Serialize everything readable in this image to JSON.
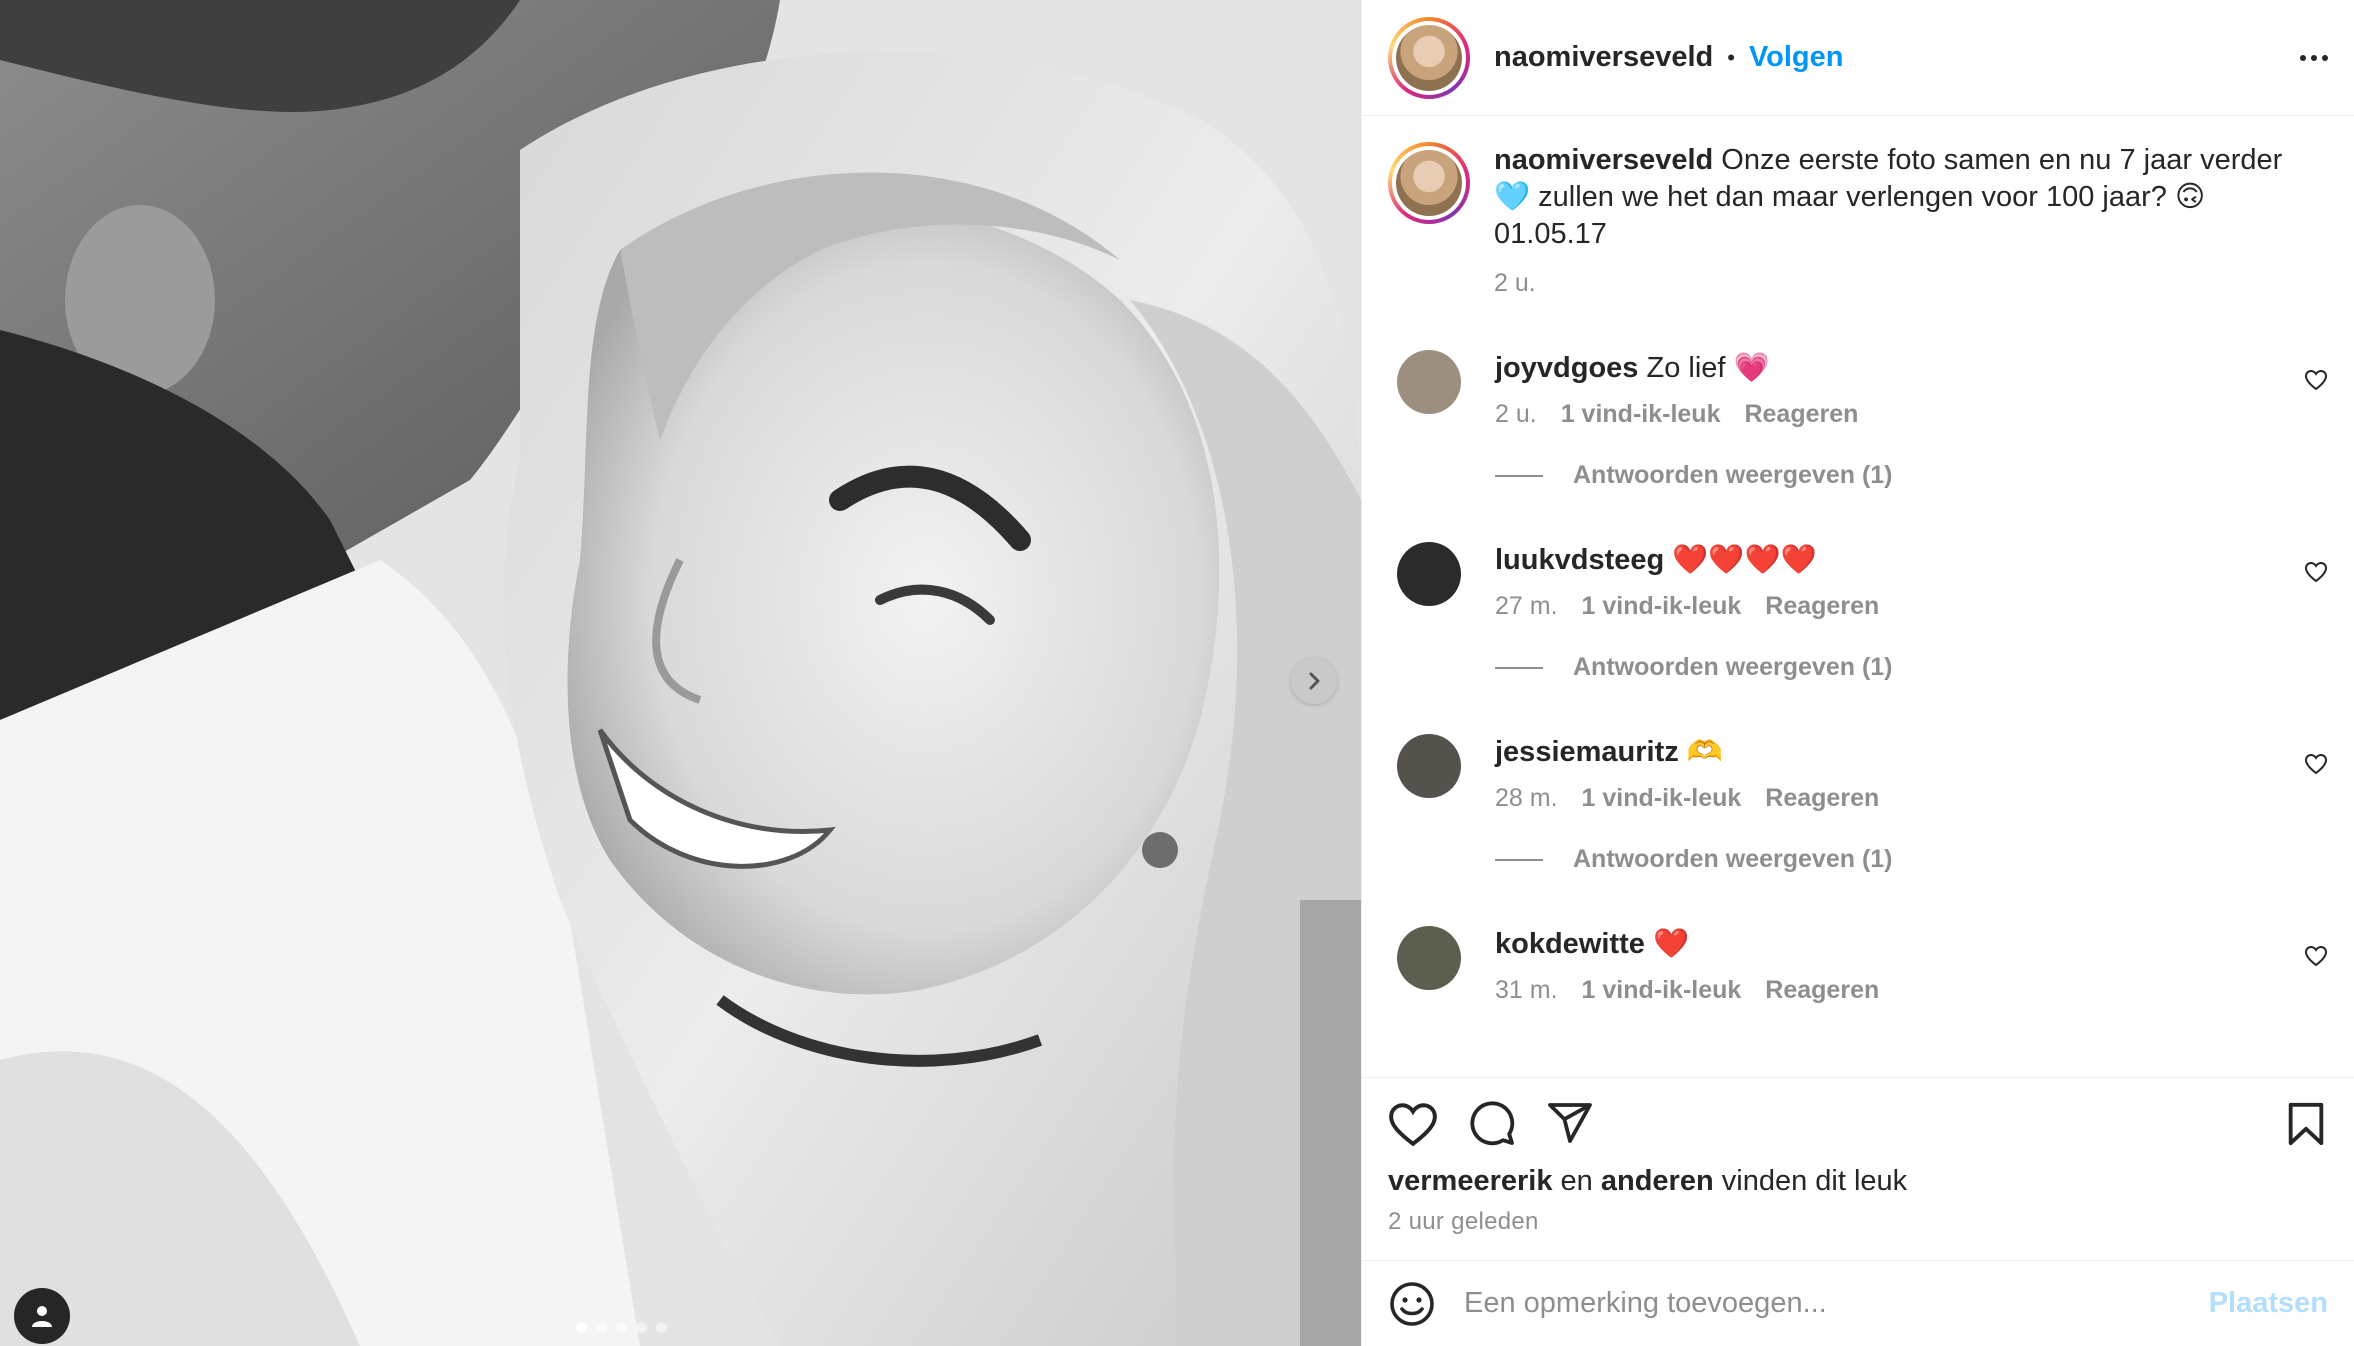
{
  "post": {
    "username": "naomiverseveld",
    "separator": "•",
    "follow_label": "Volgen",
    "caption": "Onze eerste foto samen en nu 7 jaar verder 🩵 zullen we het dan maar verlengen voor 100 jaar? 🙃 01.05.17",
    "caption_time": "2 u.",
    "carousel_slide": 1,
    "carousel_total": 5
  },
  "comments": [
    {
      "username": "joyvdgoes",
      "text": "Zo lief 💗",
      "time": "2 u.",
      "likes": "1 vind-ik-leuk",
      "reply": "Reageren",
      "view_replies": "Antwoorden weergeven (1)",
      "avatar_color": "#9c8f80"
    },
    {
      "username": "luukvdsteeg",
      "text": "❤️❤️❤️❤️",
      "time": "27 m.",
      "likes": "1 vind-ik-leuk",
      "reply": "Reageren",
      "view_replies": "Antwoorden weergeven (1)",
      "avatar_color": "#2b2b2b"
    },
    {
      "username": "jessiemauritz",
      "text": "🫶",
      "time": "28 m.",
      "likes": "1 vind-ik-leuk",
      "reply": "Reageren",
      "view_replies": "Antwoorden weergeven (1)",
      "avatar_color": "#55514d"
    },
    {
      "username": "kokdewitte",
      "text": "❤️",
      "time": "31 m.",
      "likes": "1 vind-ik-leuk",
      "reply": "Reageren",
      "avatar_color": "#5c5e4f"
    }
  ],
  "likes": {
    "first_user": "vermeererik",
    "and": "en",
    "others": "anderen",
    "suffix": "vinden dit leuk"
  },
  "posted_ago": "2 uur geleden",
  "add_comment": {
    "placeholder": "Een opmerking toevoegen...",
    "post_label": "Plaatsen"
  }
}
